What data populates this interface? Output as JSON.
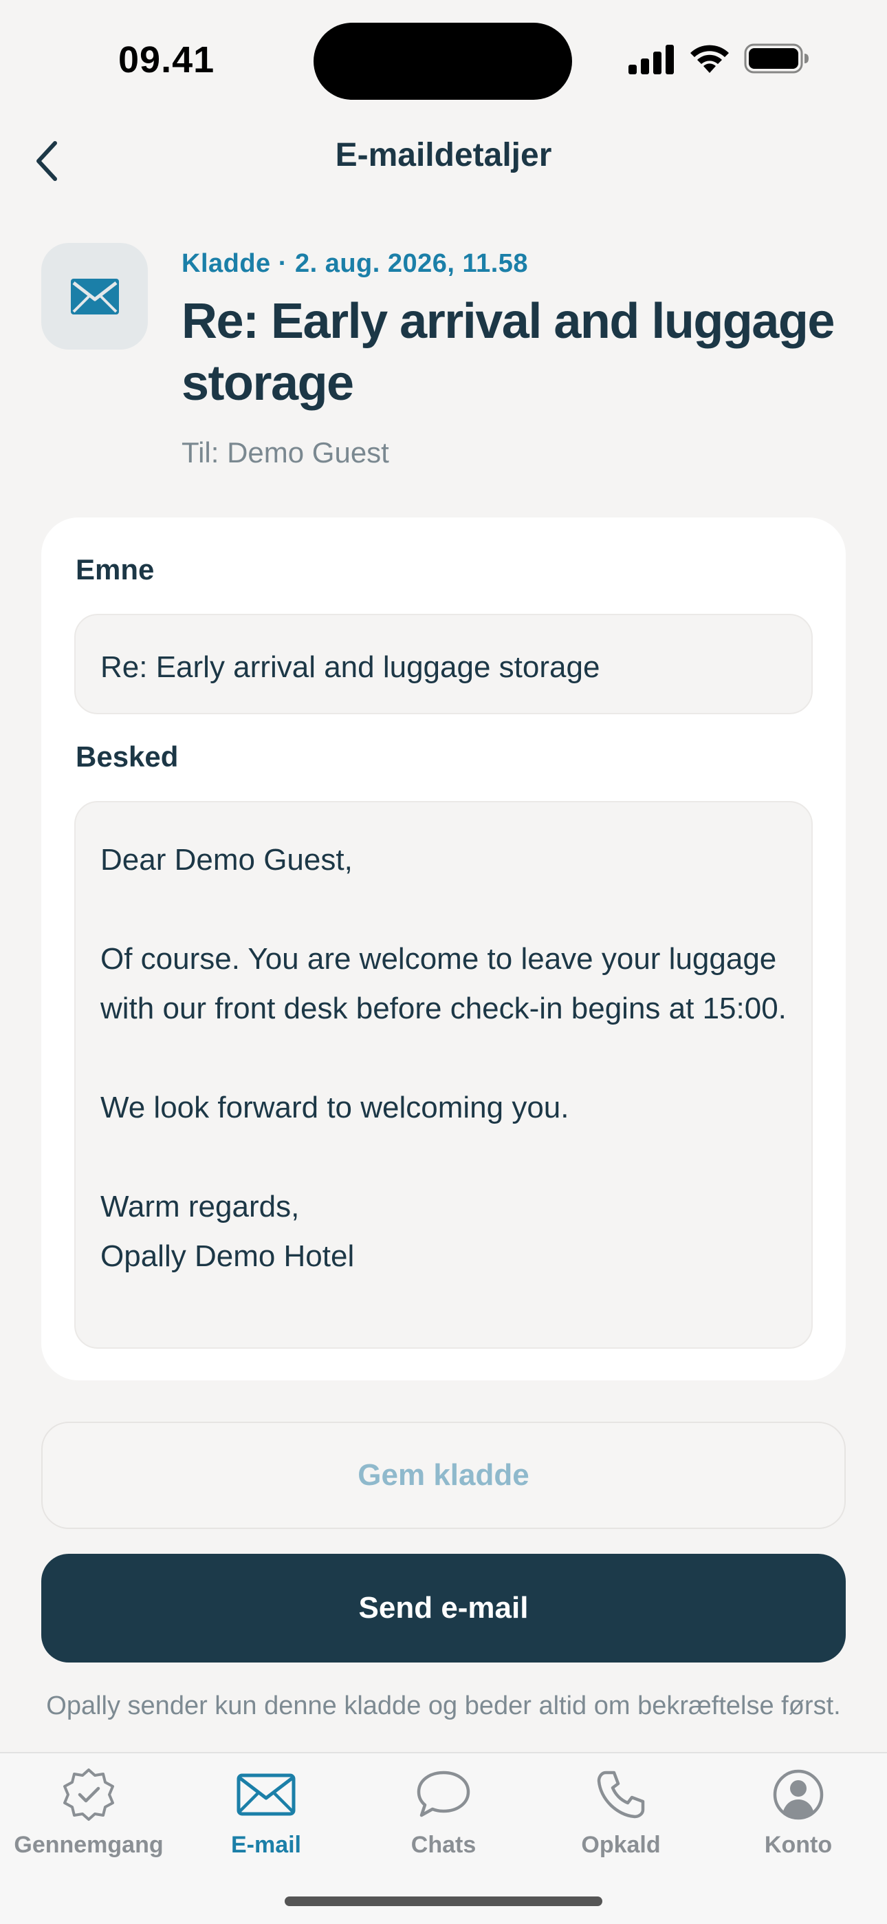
{
  "status_bar": {
    "time": "09.41"
  },
  "nav": {
    "title": "E-maildetaljer"
  },
  "header": {
    "icon": "envelope-icon",
    "meta": "Kladde · 2. aug. 2026, 11.58",
    "title": "Re: Early arrival and luggage storage",
    "recipient": "Til: Demo Guest"
  },
  "form": {
    "subject_label": "Emne",
    "subject_value": "Re: Early arrival and luggage storage",
    "message_label": "Besked",
    "message_value": "Dear Demo Guest,\n\nOf course. You are welcome to leave your luggage with our front desk before check-in begins at 15:00.\n\nWe look forward to welcoming you.\n\nWarm regards,\nOpally Demo Hotel"
  },
  "actions": {
    "save_draft_label": "Gem kladde",
    "send_label": "Send e-mail",
    "footnote": "Opally sender kun denne kladde og beder altid om bekræftelse først."
  },
  "tabs": [
    {
      "label": "Gennemgang",
      "icon": "badge-check-icon",
      "active": false
    },
    {
      "label": "E-mail",
      "icon": "envelope-icon",
      "active": true
    },
    {
      "label": "Chats",
      "icon": "chat-bubble-icon",
      "active": false
    },
    {
      "label": "Opkald",
      "icon": "phone-icon",
      "active": false
    },
    {
      "label": "Konto",
      "icon": "account-icon",
      "active": false
    }
  ],
  "colors": {
    "accent": "#1b7fa8",
    "primary_dark": "#1c3a4a",
    "background": "#f5f4f3",
    "muted_text": "#7a8890"
  }
}
